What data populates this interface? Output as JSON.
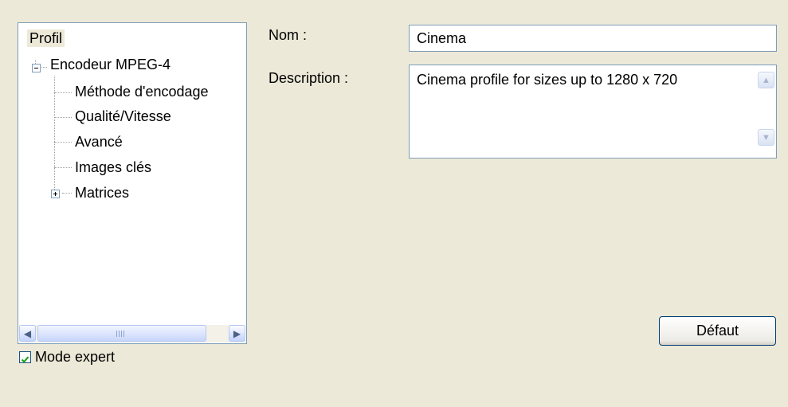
{
  "tree": {
    "items": [
      {
        "label": "Profil"
      },
      {
        "label": "Encodeur MPEG-4"
      },
      {
        "label": "Méthode d'encodage"
      },
      {
        "label": "Qualité/Vitesse"
      },
      {
        "label": "Avancé"
      },
      {
        "label": "Images clés"
      },
      {
        "label": "Matrices"
      }
    ],
    "scroll_left_glyph": "◀",
    "scroll_right_glyph": "▶"
  },
  "expert_mode": {
    "label": "Mode expert",
    "checked": true
  },
  "form": {
    "name_label": "Nom :",
    "name_value": "Cinema",
    "description_label": "Description :",
    "description_value": "Cinema profile for sizes up to 1280 x 720"
  },
  "buttons": {
    "default_label": "Défaut"
  },
  "icons": {
    "expand": "plus-box",
    "collapse": "minus-box",
    "check": "checkmark"
  },
  "colors": {
    "background": "#ECE9D8",
    "border": "#7F9DB9",
    "checkmark": "#21A121"
  }
}
